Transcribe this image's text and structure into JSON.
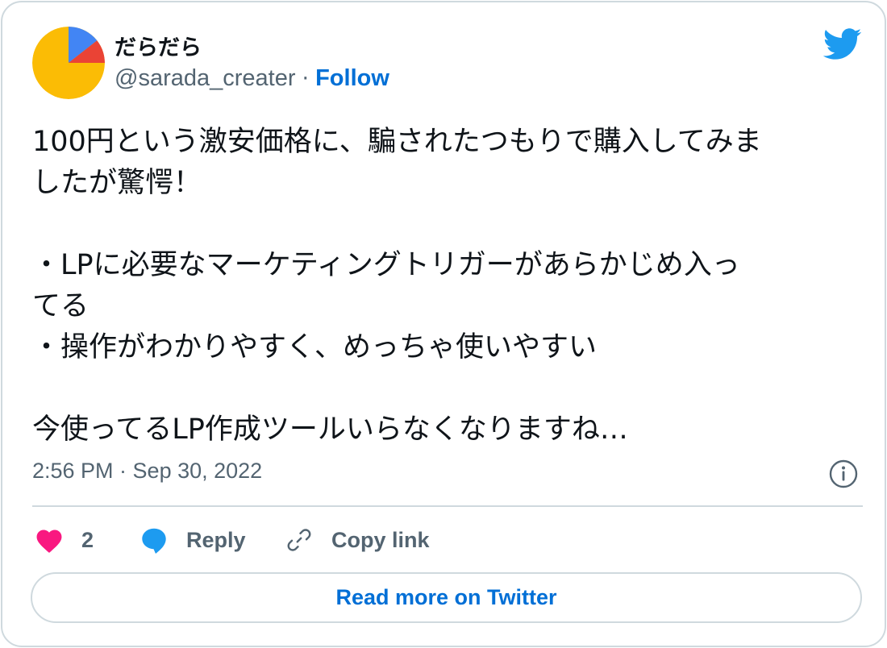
{
  "author": {
    "display_name": "だらだら",
    "handle": "@sarada_creater",
    "separator": "·",
    "follow_label": "Follow"
  },
  "tweet": {
    "lines": [
      "100円という激安価格に、騙されたつもりで購入してみま",
      "したが驚愕！",
      "",
      "・LPに必要なマーケティングトリガーがあらかじめ入っ",
      "てる",
      "・操作がわかりやすく、めっちゃ使いやすい",
      "",
      "今使ってるLP作成ツールいらなくなりますね…"
    ],
    "timestamp": "2:56 PM · Sep 30, 2022"
  },
  "actions": {
    "like_count": "2",
    "reply_label": "Reply",
    "copy_link_label": "Copy link"
  },
  "read_more_label": "Read more on Twitter",
  "icons": {
    "logo": "twitter-bird-icon",
    "info": "info-icon",
    "like": "heart-icon",
    "reply": "speech-bubble-icon",
    "copy": "link-icon"
  },
  "colors": {
    "accent": "#006fd6",
    "twitter_blue": "#1d9bf0",
    "like_red": "#f91880",
    "muted_text": "#536471",
    "border": "#cfd9de",
    "avatar_yellow": "#fbbc05",
    "avatar_red": "#ea4335",
    "avatar_blue": "#4285f4"
  }
}
